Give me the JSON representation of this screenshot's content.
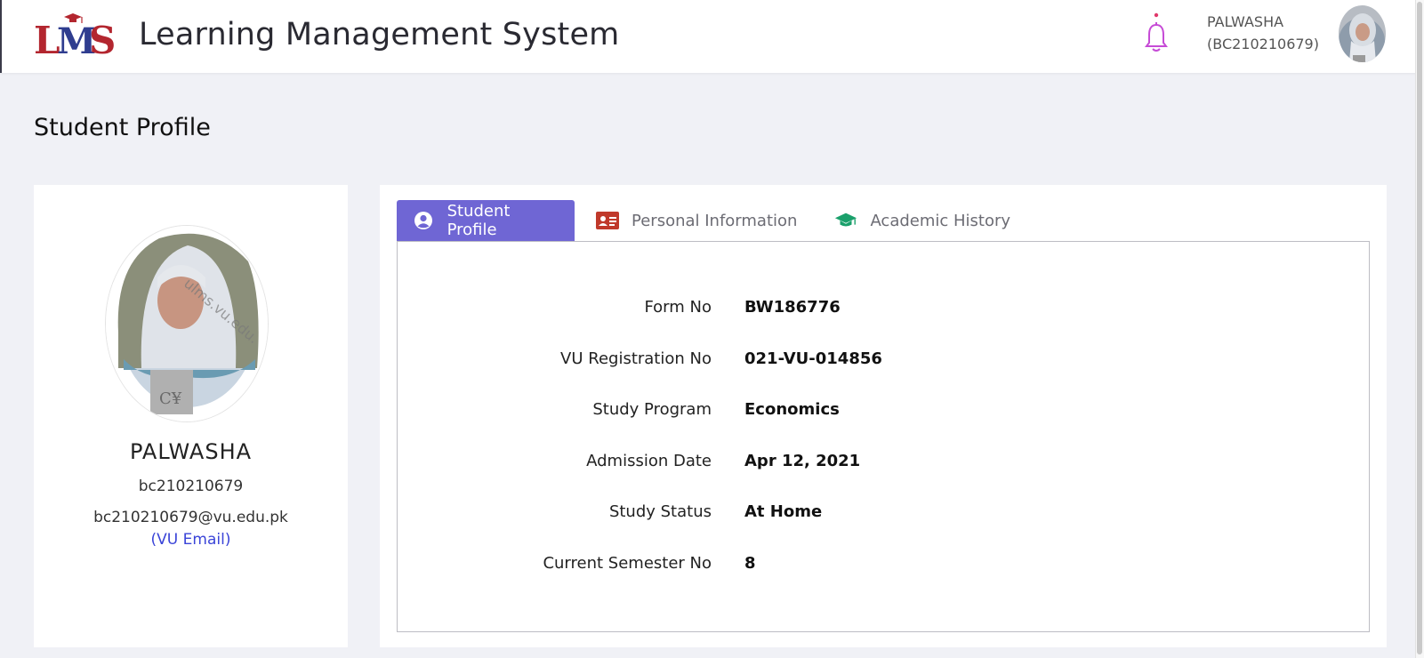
{
  "header": {
    "app_title": "Learning Management System",
    "logo_text": "LMS",
    "user_name": "PALWASHA",
    "user_id": "(BC210210679)"
  },
  "page": {
    "title": "Student Profile"
  },
  "profile_card": {
    "name": "PALWASHA",
    "id": "bc210210679",
    "email": "bc210210679@vu.edu.pk",
    "email_label": "(VU Email)"
  },
  "tabs": [
    {
      "label": "Student Profile",
      "icon": "user-circle-icon",
      "active": true
    },
    {
      "label": "Personal Information",
      "icon": "id-card-icon",
      "active": false
    },
    {
      "label": "Academic History",
      "icon": "graduation-cap-icon",
      "active": false
    }
  ],
  "details": [
    {
      "label": "Form No",
      "value": "BW186776"
    },
    {
      "label": "VU Registration No",
      "value": "021-VU-014856"
    },
    {
      "label": "Study Program",
      "value": "Economics"
    },
    {
      "label": "Admission Date",
      "value": "Apr 12, 2021"
    },
    {
      "label": "Study Status",
      "value": "At Home"
    },
    {
      "label": "Current Semester No",
      "value": "8"
    }
  ],
  "colors": {
    "accent": "#6f66d4",
    "logo_red": "#b3262f",
    "logo_blue": "#2f3d8f",
    "link_blue": "#3a44d8",
    "id_card_icon": "#c0392b",
    "cap_icon": "#1aa06b",
    "bell_icon": "#c64bd6"
  }
}
